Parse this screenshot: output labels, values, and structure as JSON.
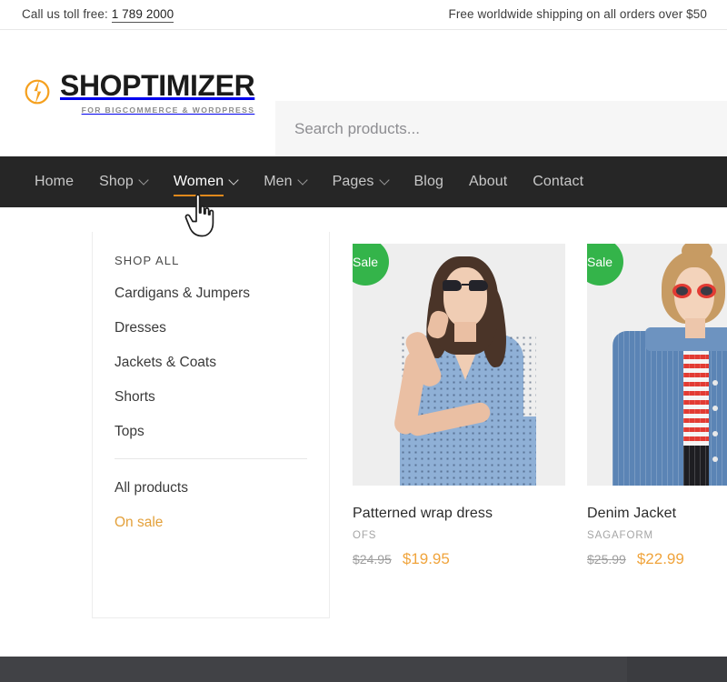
{
  "topbar": {
    "call_label": "Call us toll free:",
    "phone": "1 789 2000",
    "shipping_notice": "Free worldwide shipping on all orders over $50"
  },
  "header": {
    "logo_word": "SHOPTIMIZER",
    "logo_tagline": "FOR BIGCOMMERCE & WORDPRESS",
    "logo_icon": "lightning-bolt-circle-icon",
    "search_placeholder": "Search products...",
    "search_value": ""
  },
  "nav": {
    "items": [
      {
        "label": "Home",
        "has_dropdown": false,
        "active": false
      },
      {
        "label": "Shop",
        "has_dropdown": true,
        "active": false
      },
      {
        "label": "Women",
        "has_dropdown": true,
        "active": true
      },
      {
        "label": "Men",
        "has_dropdown": true,
        "active": false
      },
      {
        "label": "Pages",
        "has_dropdown": true,
        "active": false
      },
      {
        "label": "Blog",
        "has_dropdown": false,
        "active": false
      },
      {
        "label": "About",
        "has_dropdown": false,
        "active": false
      },
      {
        "label": "Contact",
        "has_dropdown": false,
        "active": false
      }
    ]
  },
  "dropdown": {
    "heading": "SHOP ALL",
    "categories": [
      "Cardigans & Jumpers",
      "Dresses",
      "Jackets & Coats",
      "Shorts",
      "Tops"
    ],
    "extra_links": [
      {
        "label": "All products",
        "highlighted": false
      },
      {
        "label": "On sale",
        "highlighted": true
      }
    ]
  },
  "products": [
    {
      "badge": "Sale",
      "title": "Patterned wrap dress",
      "brand": "OFS",
      "price_old": "$24.95",
      "price_new": "$19.95",
      "image_alt": "woman-in-blue-patterned-wrap-dress"
    },
    {
      "badge": "Sale",
      "title": "Denim Jacket",
      "brand": "SAGAFORM",
      "price_old": "$25.99",
      "price_new": "$22.99",
      "image_alt": "woman-in-blue-denim-jacket"
    }
  ],
  "colors": {
    "accent_orange": "#e0891c",
    "sale_price_orange": "#f0a43c",
    "badge_green": "#34b44a",
    "nav_dark": "#262626",
    "bottom_band": "#414246"
  },
  "cursor": {
    "type": "pointing-hand-cursor"
  }
}
